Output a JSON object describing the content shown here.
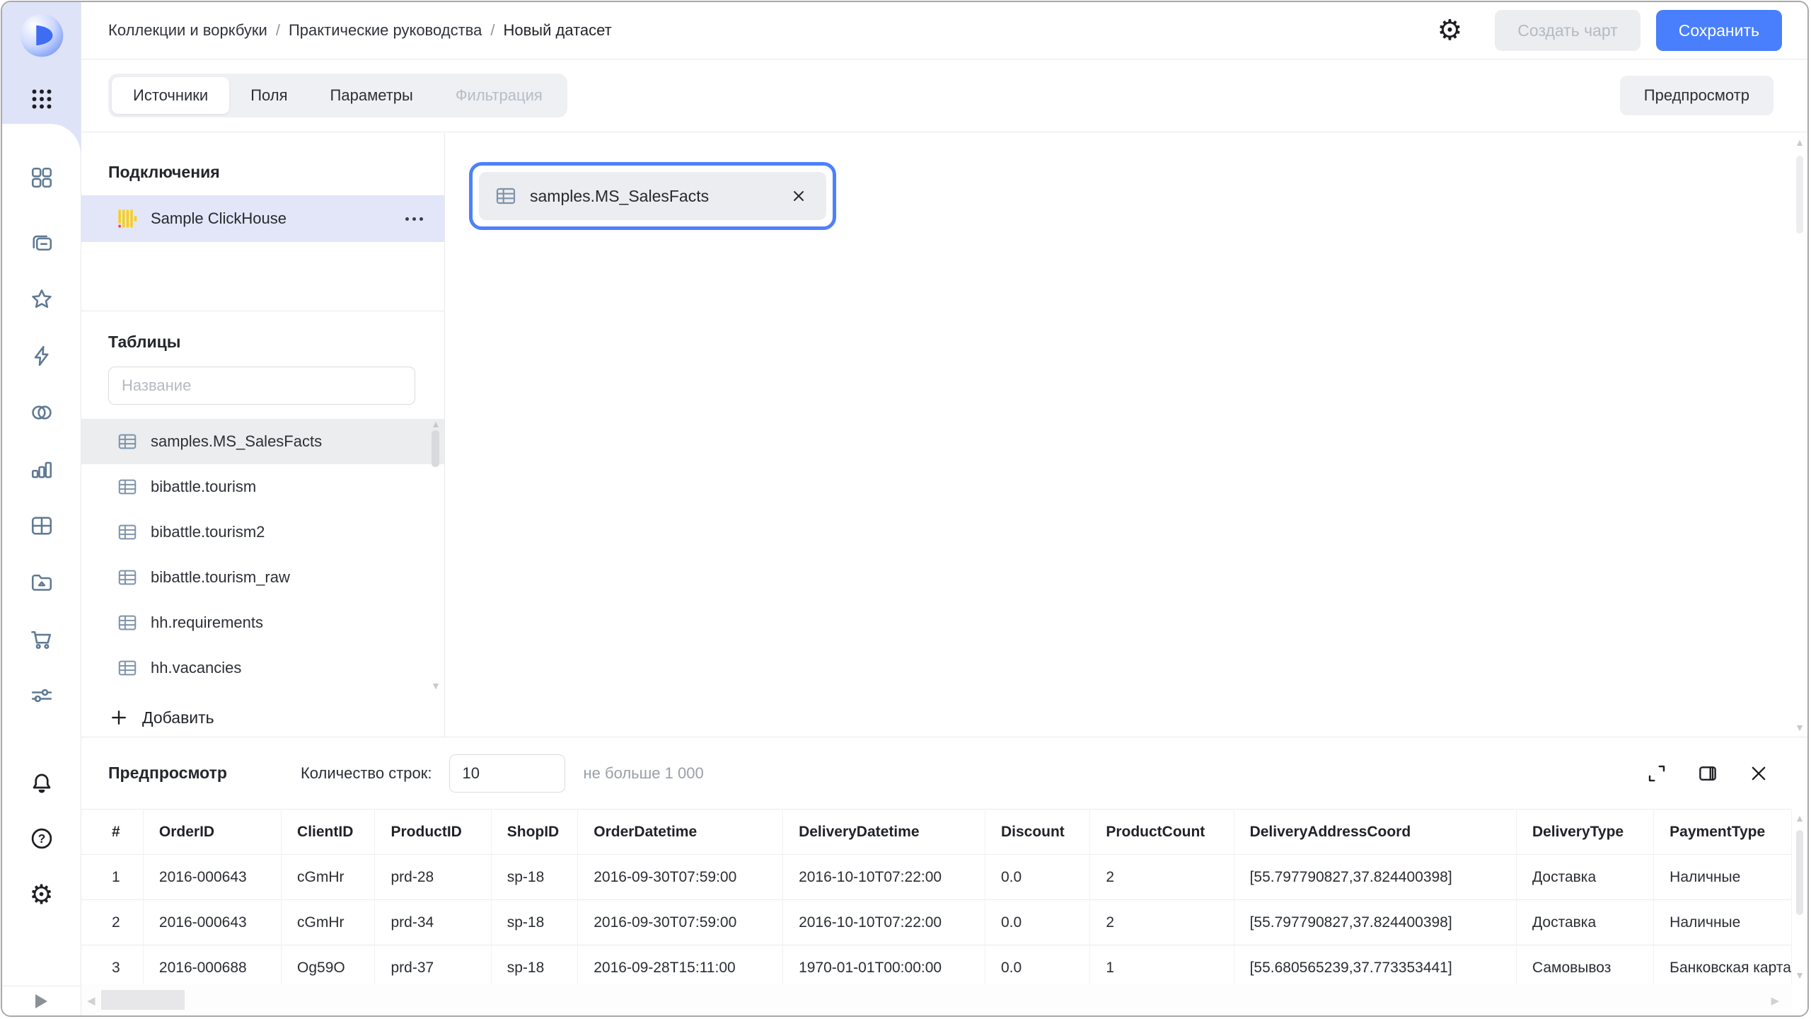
{
  "topbar": {
    "breadcrumb": {
      "items": [
        "Коллекции и воркбуки",
        "Практические руководства",
        "Новый датасет"
      ],
      "separator": "/"
    },
    "create_chart_button": "Создать чарт",
    "save_button": "Сохранить"
  },
  "tabs": {
    "sources": "Источники",
    "fields": "Поля",
    "parameters": "Параметры",
    "filtering": "Фильтрация",
    "preview_button": "Предпросмотр"
  },
  "connections": {
    "title": "Подключения",
    "item": "Sample ClickHouse"
  },
  "tables": {
    "title": "Таблицы",
    "search_placeholder": "Название",
    "items": [
      "samples.MS_SalesFacts",
      "bibattle.tourism",
      "bibattle.tourism2",
      "bibattle.tourism_raw",
      "hh.requirements",
      "hh.vacancies"
    ],
    "add_button": "Добавить"
  },
  "canvas": {
    "selected_table": "samples.MS_SalesFacts"
  },
  "preview": {
    "title": "Предпросмотр",
    "row_count_label": "Количество строк:",
    "row_count_value": "10",
    "row_count_hint": "не больше 1 000",
    "columns": [
      "#",
      "OrderID",
      "ClientID",
      "ProductID",
      "ShopID",
      "OrderDatetime",
      "DeliveryDatetime",
      "Discount",
      "ProductCount",
      "DeliveryAddressCoord",
      "DeliveryType",
      "PaymentType"
    ],
    "rows": [
      [
        "1",
        "2016-000643",
        "cGmHr",
        "prd-28",
        "sp-18",
        "2016-09-30T07:59:00",
        "2016-10-10T07:22:00",
        "0.0",
        "2",
        "[55.797790827,37.824400398]",
        "Доставка",
        "Наличные"
      ],
      [
        "2",
        "2016-000643",
        "cGmHr",
        "prd-34",
        "sp-18",
        "2016-09-30T07:59:00",
        "2016-10-10T07:22:00",
        "0.0",
        "2",
        "[55.797790827,37.824400398]",
        "Доставка",
        "Наличные"
      ],
      [
        "3",
        "2016-000688",
        "Og59O",
        "prd-37",
        "sp-18",
        "2016-09-28T15:11:00",
        "1970-01-01T00:00:00",
        "0.0",
        "1",
        "[55.680565239,37.773353441]",
        "Самовывоз",
        "Банковская карта"
      ]
    ]
  },
  "colors": {
    "accent_blue": "#497ffc",
    "chip_border_blue": "#4e80fc",
    "sidebar_highlight": "#dfe3f7",
    "connection_selected": "#e2e6f8",
    "list_selected": "#ebedef",
    "clickhouse_yellow": "#ffcc00",
    "clickhouse_red": "#f53b3b"
  }
}
